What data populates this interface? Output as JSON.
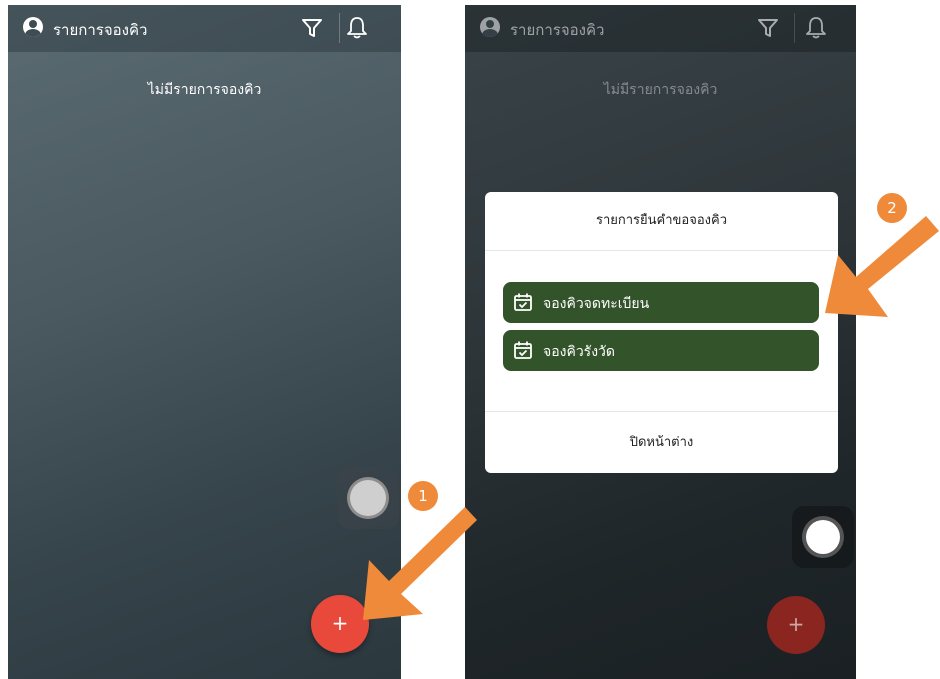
{
  "left_screen": {
    "header": {
      "title": "รายการจองคิว",
      "icons": [
        "user-avatar-icon",
        "filter-icon",
        "bell-icon"
      ]
    },
    "empty_message": "ไม่มีรายการจองคิว",
    "fab": {
      "label": "+",
      "color": "#e9493b"
    },
    "step_badge": "1"
  },
  "right_screen": {
    "header": {
      "title": "รายการจองคิว",
      "icons": [
        "user-avatar-icon",
        "filter-icon",
        "bell-icon"
      ]
    },
    "empty_message": "ไม่มีรายการจองคิว",
    "fab": {
      "label": "+",
      "color": "#8a2520"
    },
    "step_badge": "2",
    "modal": {
      "title": "รายการยืนคำขอจองคิว",
      "options": [
        {
          "label": "จองคิวจดทะเบียน",
          "icon": "calendar-check-icon"
        },
        {
          "label": "จองคิวรังวัด",
          "icon": "calendar-check-icon"
        }
      ],
      "close_label": "ปิดหน้าต่าง",
      "button_color": "#33542a"
    }
  },
  "annotation_color": "#ee8a3a"
}
